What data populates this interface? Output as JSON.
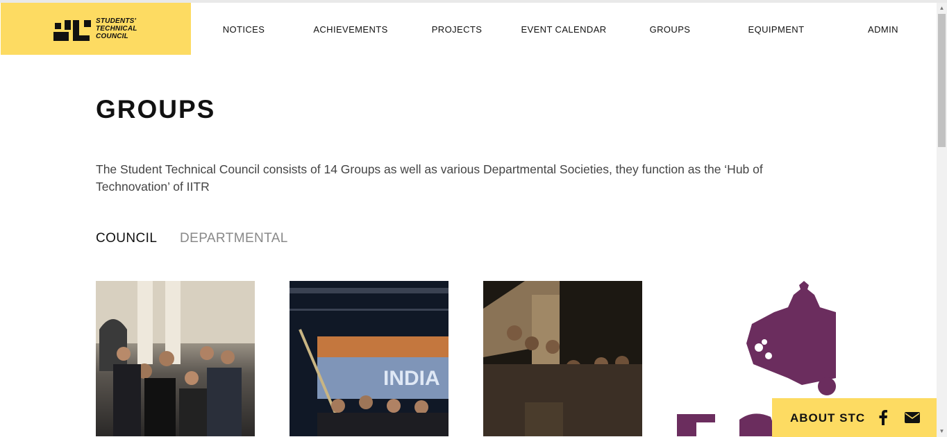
{
  "logo": {
    "line1": "STUDENTS'",
    "line2": "TECHNICAL",
    "line3": "COUNCIL",
    "bg_color": "#fddb62"
  },
  "nav": {
    "items": [
      {
        "label": "NOTICES"
      },
      {
        "label": "ACHIEVEMENTS"
      },
      {
        "label": "PROJECTS"
      },
      {
        "label": "EVENT CALENDAR"
      },
      {
        "label": "GROUPS"
      },
      {
        "label": "EQUIPMENT"
      },
      {
        "label": "ADMIN"
      }
    ]
  },
  "main": {
    "title": "GROUPS",
    "intro": "The Student Technical Council consists of 14 Groups as well as various Departmental Societies, they function as the ‘Hub of Technovation’ of IITR",
    "tabs": [
      {
        "label": "COUNCIL",
        "active": true
      },
      {
        "label": "DEPARTMENTAL",
        "active": false
      }
    ]
  },
  "about": {
    "label": "ABOUT STC",
    "icons": [
      "facebook-icon",
      "mail-icon"
    ]
  },
  "colors": {
    "accent": "#fddb62",
    "group_logo_purple": "#6b2d5e"
  }
}
